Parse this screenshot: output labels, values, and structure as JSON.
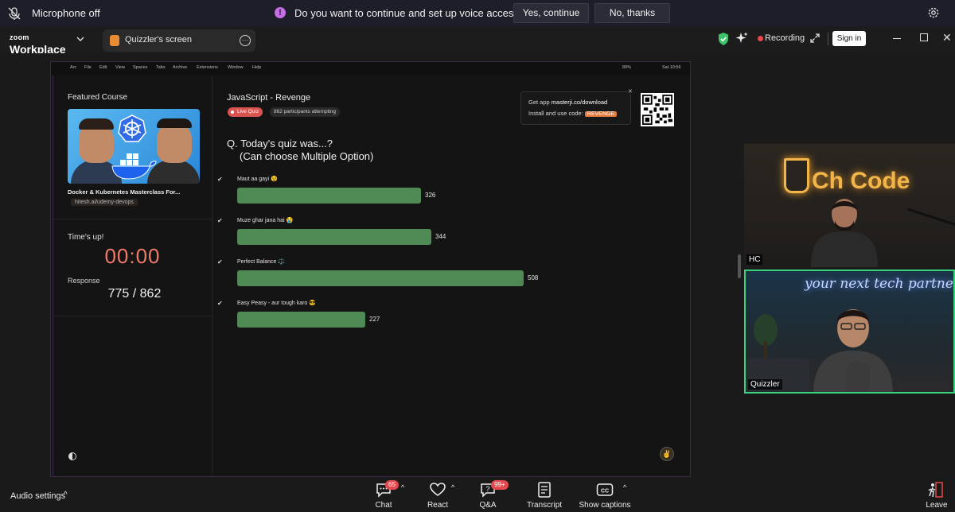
{
  "banner": {
    "mic_label": "Microphone off",
    "question": "Do you want to continue and set up voice access?",
    "yes_label": "Yes, continue",
    "no_label": "No, thanks"
  },
  "zoom": {
    "logo_top": "zoom",
    "logo_bottom": "Workplace",
    "tab_label": "Quizzler's screen",
    "recording_label": "Recording",
    "signin_label": "Sign in"
  },
  "mac_menu": [
    "Arc",
    "File",
    "Edit",
    "View",
    "Spaces",
    "Tabs",
    "Archive",
    "Extensions",
    "Window",
    "Help"
  ],
  "mac_status": {
    "battery": "80%",
    "clock": "Sat 10:56"
  },
  "course": {
    "section_title": "Featured Course",
    "name": "Docker & Kubernetes Masterclass For...",
    "link": "hitesh.ai/udemy-devops"
  },
  "timer": {
    "label": "Time's up!",
    "value": "00:00",
    "response_label": "Response",
    "response_value": "775 / 862"
  },
  "quiz": {
    "title": "JavaScript - Revenge",
    "live_label": "Live Quiz",
    "participants": "862 participants attempting",
    "question_line1": "Q. Today's quiz was...?",
    "question_line2": "(Can choose Multiple Option)",
    "max_count": 508,
    "options": [
      {
        "text": "Maut aa gayi 😵",
        "count": 326
      },
      {
        "text": "Muze ghar jana hai 😭",
        "count": 344
      },
      {
        "text": "Perfect Balance ⚖️",
        "count": 508
      },
      {
        "text": "Easy Peasy - aur tough karo 😎",
        "count": 227
      }
    ]
  },
  "promo": {
    "line1_prefix": "Get app ",
    "line1_link": "masterji.co/download",
    "line2_prefix": "Install and use code: ",
    "code": "REVENGE"
  },
  "videos": {
    "top_label": "HC",
    "top_sign": "Ch  Code",
    "bottom_label": "Quizzler",
    "bottom_neon": "your next tech partner"
  },
  "toolbar": {
    "audio_settings": "Audio settings",
    "chat": "Chat",
    "chat_badge": "65",
    "react": "React",
    "qa": "Q&A",
    "qa_badge": "99+",
    "transcript": "Transcript",
    "captions": "Show captions",
    "leave": "Leave"
  }
}
